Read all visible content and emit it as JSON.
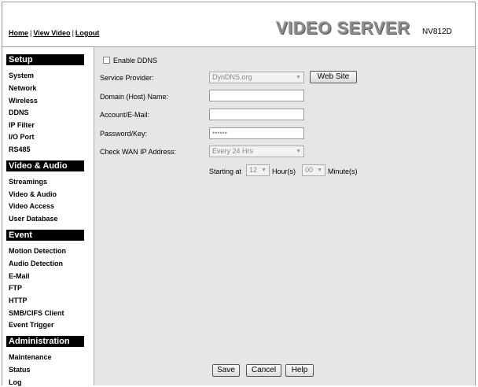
{
  "header": {
    "links": [
      "Home",
      "View Video",
      "Logout"
    ],
    "brand": "VIDEO SERVER",
    "model": "NV812D"
  },
  "sidebar": {
    "setup": {
      "title": "Setup",
      "items": [
        "System",
        "Network",
        "Wireless",
        "DDNS",
        "IP Filter",
        "I/O Port",
        "RS485"
      ]
    },
    "video_audio": {
      "title": "Video & Audio",
      "items": [
        "Streamings",
        "Video & Audio",
        "Video Access",
        "User Database"
      ]
    },
    "event": {
      "title": "Event",
      "items": [
        "Motion Detection",
        "Audio Detection",
        "E-Mail",
        "FTP",
        "HTTP",
        "SMB/CIFS Client",
        "Event Trigger"
      ]
    },
    "administration": {
      "title": "Administration",
      "items": [
        "Maintenance",
        "Status",
        "Log"
      ]
    },
    "active_item": "DDNS"
  },
  "form": {
    "enable_ddns_label": "Enable DDNS",
    "enable_ddns_checked": false,
    "service_provider_label": "Service Provider:",
    "service_provider_value": "DynDNS.org",
    "web_site_button": "Web Site",
    "domain_label": "Domain (Host) Name:",
    "domain_value": "",
    "account_label": "Account/E-Mail:",
    "account_value": "",
    "password_label": "Password/Key:",
    "password_value": "••••••",
    "check_wan_label": "Check WAN IP Address:",
    "check_wan_value": "Every 24 Hrs",
    "starting_at_label": "Starting at",
    "hour_value": "12",
    "hour_unit": "Hour(s)",
    "minute_value": "00",
    "minute_unit": "Minute(s)"
  },
  "buttons": {
    "save": "Save",
    "cancel": "Cancel",
    "help": "Help"
  },
  "colors": {
    "content_bg": "#e6e6e6",
    "section_header_bg": "#000000",
    "section_header_text": "#ffffff"
  },
  "icons": {
    "dropdown": "chevron-down-icon"
  }
}
